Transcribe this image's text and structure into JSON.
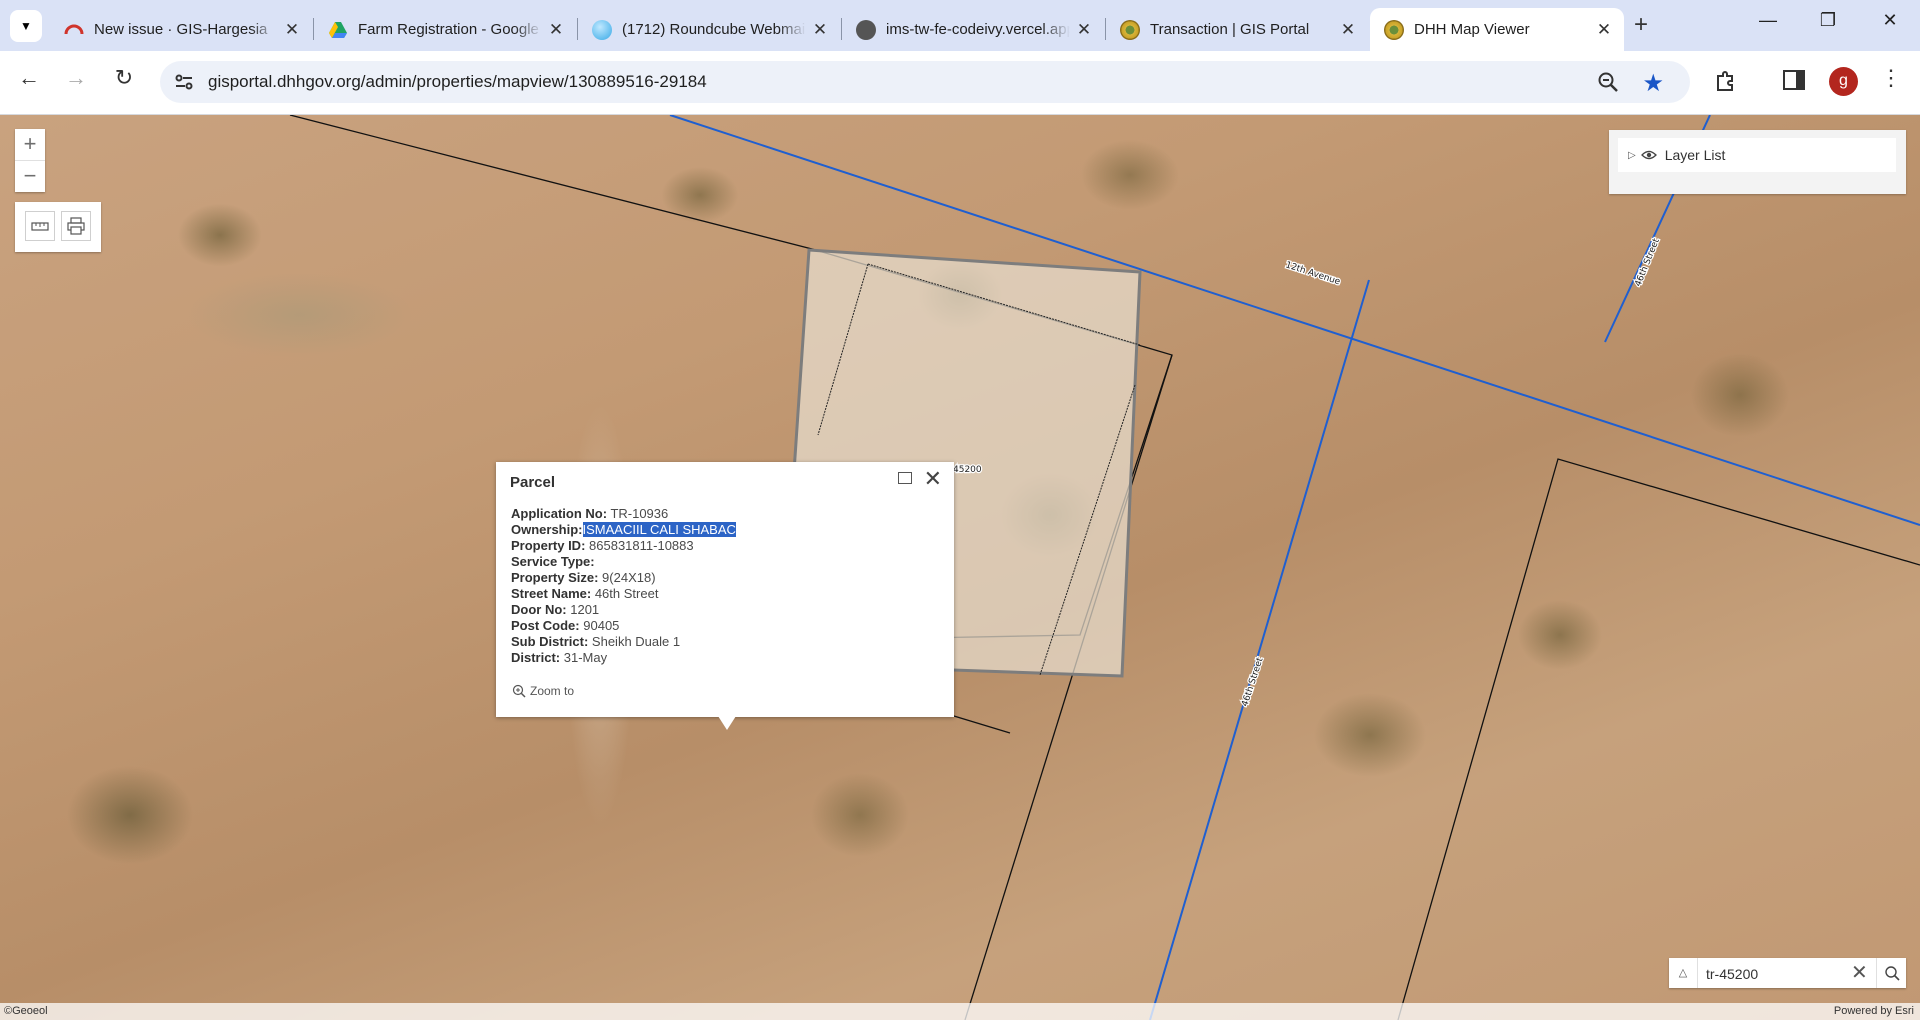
{
  "browser": {
    "tabs": [
      {
        "title": "New issue · GIS-Hargesia",
        "icon": "gitlab-icon",
        "color": "#e2432a"
      },
      {
        "title": "Farm Registration - Google",
        "icon": "google-drive-icon",
        "color": "#1fa463"
      },
      {
        "title": "(1712) Roundcube Webmail",
        "icon": "roundcube-icon",
        "color": "#37beff"
      },
      {
        "title": "ims-tw-fe-codeivy.vercel.app",
        "icon": "globe-icon",
        "color": "#444444"
      },
      {
        "title": "Transaction | GIS Portal",
        "icon": "gis-portal-icon",
        "color": "#c9a227"
      },
      {
        "title": "DHH Map Viewer",
        "icon": "gis-portal-icon",
        "color": "#c9a227"
      }
    ],
    "url": "gisportal.dhhgov.org/admin/properties/mapview/130889516-29184",
    "profile_initial": "g"
  },
  "map": {
    "zoom_in": "+",
    "zoom_out": "−",
    "layer_list_label": "Layer List",
    "street_labels": [
      "12th Avenue",
      "46th Street",
      "46th Street"
    ],
    "parcel_label": "45200",
    "popup": {
      "title": "Parcel",
      "fields": [
        {
          "label": "Application No:",
          "value": "TR-10936"
        },
        {
          "label": "Ownership:",
          "value": "ISMAACIIL CALI SHABAC"
        },
        {
          "label": "Property ID:",
          "value": "865831811-10883"
        },
        {
          "label": "Service Type:",
          "value": ""
        },
        {
          "label": "Property Size:",
          "value": "9(24X18)"
        },
        {
          "label": "Street Name:",
          "value": "46th Street"
        },
        {
          "label": "Door No:",
          "value": "1201"
        },
        {
          "label": "Post Code:",
          "value": "90405"
        },
        {
          "label": "Sub District:",
          "value": "Sheikh Duale 1"
        },
        {
          "label": "District:",
          "value": "31-May"
        }
      ],
      "zoom_to_label": "Zoom to"
    },
    "search_value": "tr-45200",
    "attribution_left": "©Geoeol",
    "attribution_right": "Powered by Esri"
  }
}
